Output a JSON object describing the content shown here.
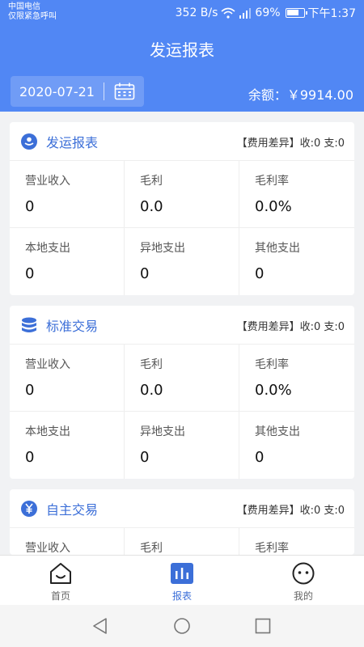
{
  "status": {
    "carrier_line1": "中国电信",
    "carrier_line2": "仅限紧急呼叫",
    "speed": "352 B/s",
    "battery_pct": "69%",
    "time": "下午1:37"
  },
  "header": {
    "title": "发运报表",
    "date": "2020-07-21",
    "balance": "余额：￥9914.00"
  },
  "cards": [
    {
      "title": "发运报表",
      "icon": "shipping-icon",
      "diff": "【费用差异】收:0  支:0",
      "metrics": [
        {
          "label": "营业收入",
          "value": "0"
        },
        {
          "label": "毛利",
          "value": "0.0"
        },
        {
          "label": "毛利率",
          "value": "0.0%"
        },
        {
          "label": "本地支出",
          "value": "0"
        },
        {
          "label": "异地支出",
          "value": "0"
        },
        {
          "label": "其他支出",
          "value": "0"
        }
      ]
    },
    {
      "title": "标准交易",
      "icon": "database-icon",
      "diff": "【费用差异】收:0  支:0",
      "metrics": [
        {
          "label": "营业收入",
          "value": "0"
        },
        {
          "label": "毛利",
          "value": "0.0"
        },
        {
          "label": "毛利率",
          "value": "0.0%"
        },
        {
          "label": "本地支出",
          "value": "0"
        },
        {
          "label": "异地支出",
          "value": "0"
        },
        {
          "label": "其他支出",
          "value": "0"
        }
      ]
    },
    {
      "title": "自主交易",
      "icon": "yen-icon",
      "diff": "【费用差异】收:0  支:0",
      "metrics": [
        {
          "label": "营业收入",
          "value": ""
        },
        {
          "label": "毛利",
          "value": ""
        },
        {
          "label": "毛利率",
          "value": ""
        }
      ]
    }
  ],
  "tabs": [
    {
      "label": "首页",
      "icon": "home-icon"
    },
    {
      "label": "报表",
      "icon": "report-icon"
    },
    {
      "label": "我的",
      "icon": "profile-icon"
    }
  ],
  "colors": {
    "primary": "#5187f4",
    "accent_text": "#3c6fd8",
    "background": "#f1f2f4"
  }
}
